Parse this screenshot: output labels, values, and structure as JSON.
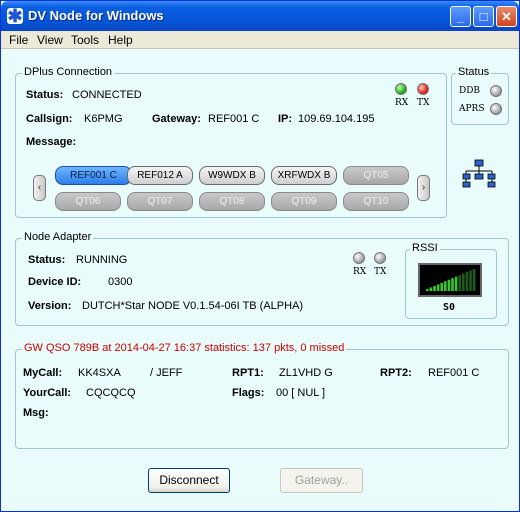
{
  "window": {
    "title": "DV Node for Windows",
    "icon": "dv-node-app-icon"
  },
  "titlebar_buttons": {
    "minimize": "_",
    "maximize": "□",
    "close": "✕"
  },
  "menu": [
    "File",
    "View",
    "Tools",
    "Help"
  ],
  "dplus": {
    "group_title": "DPlus Connection",
    "status_label": "Status:",
    "status_value": "CONNECTED",
    "callsign_label": "Callsign:",
    "callsign_value": "K6PMG",
    "gateway_label": "Gateway:",
    "gateway_value": "REF001 C",
    "ip_label": "IP:",
    "ip_value": "109.69.104.195",
    "message_label": "Message:",
    "rx_label": "RX",
    "tx_label": "TX",
    "left_arrow": "‹",
    "right_arrow": "›",
    "buttons_row1": [
      "REF001 C",
      "REF012 A",
      "W9WDX  B",
      "XRFWDX B",
      "QT05"
    ],
    "buttons_row2": [
      "QT06",
      "QT07",
      "QT08",
      "QT09",
      "QT10"
    ]
  },
  "status_panel": {
    "group_title": "Status",
    "ddb_label": "DDB",
    "aprs_label": "APRS"
  },
  "network_icon": "network-tree-icon",
  "node_adapter": {
    "group_title": "Node Adapter",
    "status_label": "Status:",
    "status_value": "RUNNING",
    "device_label": "Device ID:",
    "device_value": "0300",
    "version_label": "Version:",
    "version_value": "DUTCH*Star NODE V0.1.54-06I TB (ALPHA)",
    "rx_label": "RX",
    "tx_label": "TX",
    "rssi_title": "RSSI",
    "rssi_value": "S0",
    "rssi_level": 0.6
  },
  "qso": {
    "title": "GW QSO 789B at 2014-04-27 16:37  statistics: 137 pkts, 0 missed",
    "mycall_label": "MyCall:",
    "mycall_value": "KK4SXA",
    "mycall_suffix": "/ JEFF",
    "rpt1_label": "RPT1:",
    "rpt1_value": "ZL1VHD G",
    "rpt2_label": "RPT2:",
    "rpt2_value": "REF001 C",
    "yourcall_label": "YourCall:",
    "yourcall_value": "CQCQCQ",
    "flags_label": "Flags:",
    "flags_value": "00 [ NUL ]",
    "msg_label": "Msg:"
  },
  "buttons": {
    "disconnect": "Disconnect",
    "gateway": "Gateway.."
  },
  "colors": {
    "title_blue": "#0654d6",
    "qso_title": "#cc0000",
    "bg": "#e9fbfb"
  }
}
